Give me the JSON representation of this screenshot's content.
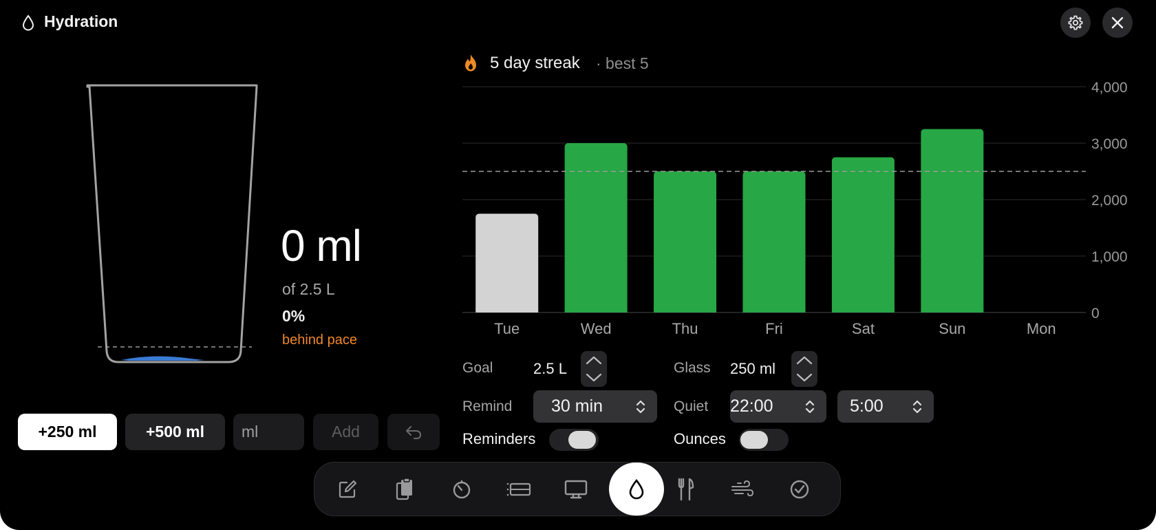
{
  "window": {
    "title": "Hydration",
    "title_icon": "water-drop-icon"
  },
  "header_actions": {
    "settings_icon": "gear-icon",
    "close_icon": "close-icon"
  },
  "today": {
    "amount": "0 ml",
    "of_goal": "of 2.5 L",
    "percent": "0%",
    "pace": "behind pace",
    "fill_fraction": 0.0,
    "goal_line_label": ""
  },
  "quick_add": {
    "add_250": "+250 ml",
    "add_500": "+500 ml",
    "custom_placeholder": "ml",
    "add_label": "Add",
    "undo_icon": "undo-icon"
  },
  "streak": {
    "icon": "flame-icon",
    "text": "5 day streak",
    "best": "· best 5"
  },
  "chart_data": {
    "type": "bar",
    "categories": [
      "Tue",
      "Wed",
      "Thu",
      "Fri",
      "Sat",
      "Sun",
      "Mon"
    ],
    "values": [
      1750,
      3000,
      2500,
      2500,
      2750,
      3250,
      0
    ],
    "met_goal": [
      false,
      true,
      true,
      true,
      true,
      true,
      false
    ],
    "goal_line": 2500,
    "ylim": [
      0,
      4000
    ],
    "yticks": [
      "0",
      "1,000",
      "2,000",
      "3,000",
      "4,000"
    ],
    "ytick_values": [
      0,
      1000,
      2000,
      3000,
      4000
    ],
    "axis_side": "right",
    "grid": true,
    "colors": {
      "met": "#27a745",
      "not_met": "#d3d3d3",
      "goal_line": "#8a8a8a"
    }
  },
  "settings": {
    "goal_label": "Goal",
    "goal_value": "2.5 L",
    "glass_label": "Glass",
    "glass_value": "250 ml",
    "remind_label": "Remind",
    "remind_value": "30 min",
    "quiet_label": "Quiet",
    "quiet_start": "22:00",
    "quiet_end": "5:00",
    "reminders_label": "Reminders",
    "reminders_on": false,
    "ounces_label": "Ounces",
    "ounces_on": false
  },
  "dock": {
    "items": [
      "note-icon",
      "clipboard-icon",
      "timer-icon",
      "list-icon",
      "display-icon",
      "water-drop-icon",
      "fork-knife-icon",
      "wind-icon",
      "checkmark-circle-icon"
    ],
    "active": "water-drop-icon"
  },
  "colors": {
    "background": "#000000",
    "accent_orange": "#f0872b",
    "green": "#27a745",
    "water": "#3a7bd5"
  }
}
